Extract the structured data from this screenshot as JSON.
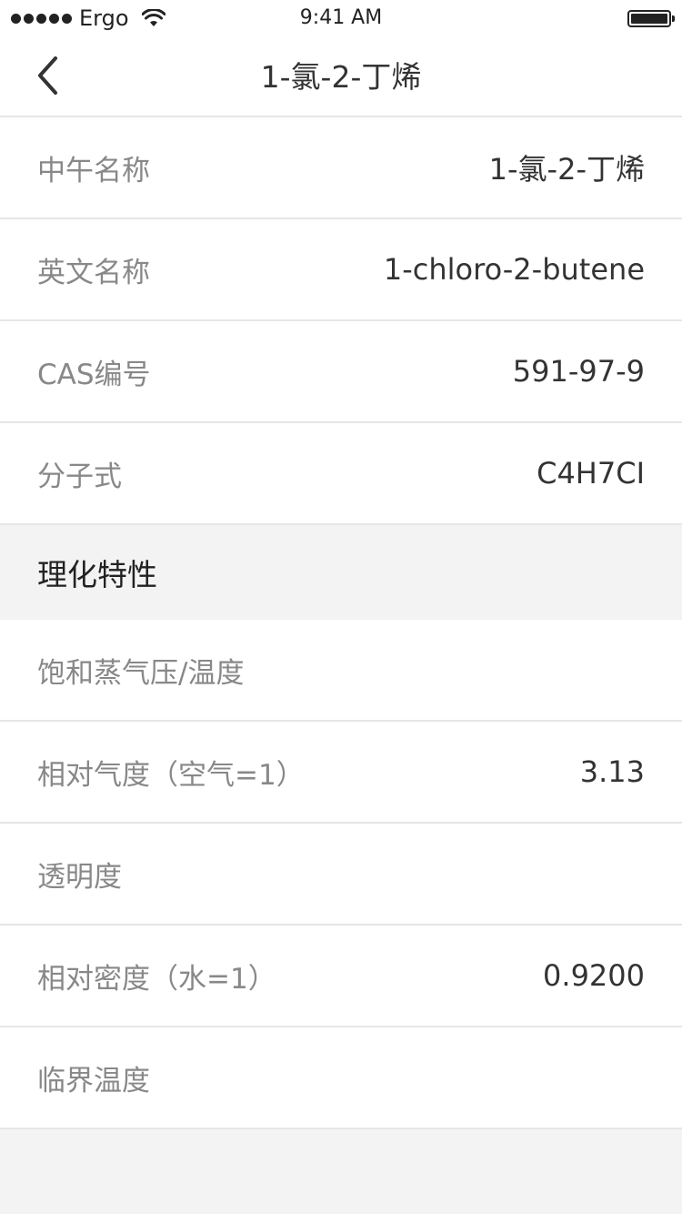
{
  "status_bar": {
    "carrier": "Ergo",
    "time": "9:41 AM"
  },
  "nav": {
    "title": "1-氯-2-丁烯"
  },
  "basic_info": [
    {
      "label": "中午名称",
      "value": "1-氯-2-丁烯"
    },
    {
      "label": "英文名称",
      "value": "1-chloro-2-butene"
    },
    {
      "label": "CAS编号",
      "value": "591-97-9"
    },
    {
      "label": "分子式",
      "value": "C4H7CI"
    }
  ],
  "section": {
    "title": "理化特性"
  },
  "properties": [
    {
      "label": "饱和蒸气压/温度",
      "value": ""
    },
    {
      "label": "相对气度（空气=1）",
      "value": "3.13"
    },
    {
      "label": "透明度",
      "value": ""
    },
    {
      "label": "相对密度（水=1）",
      "value": "0.9200"
    },
    {
      "label": "临界温度",
      "value": ""
    }
  ]
}
